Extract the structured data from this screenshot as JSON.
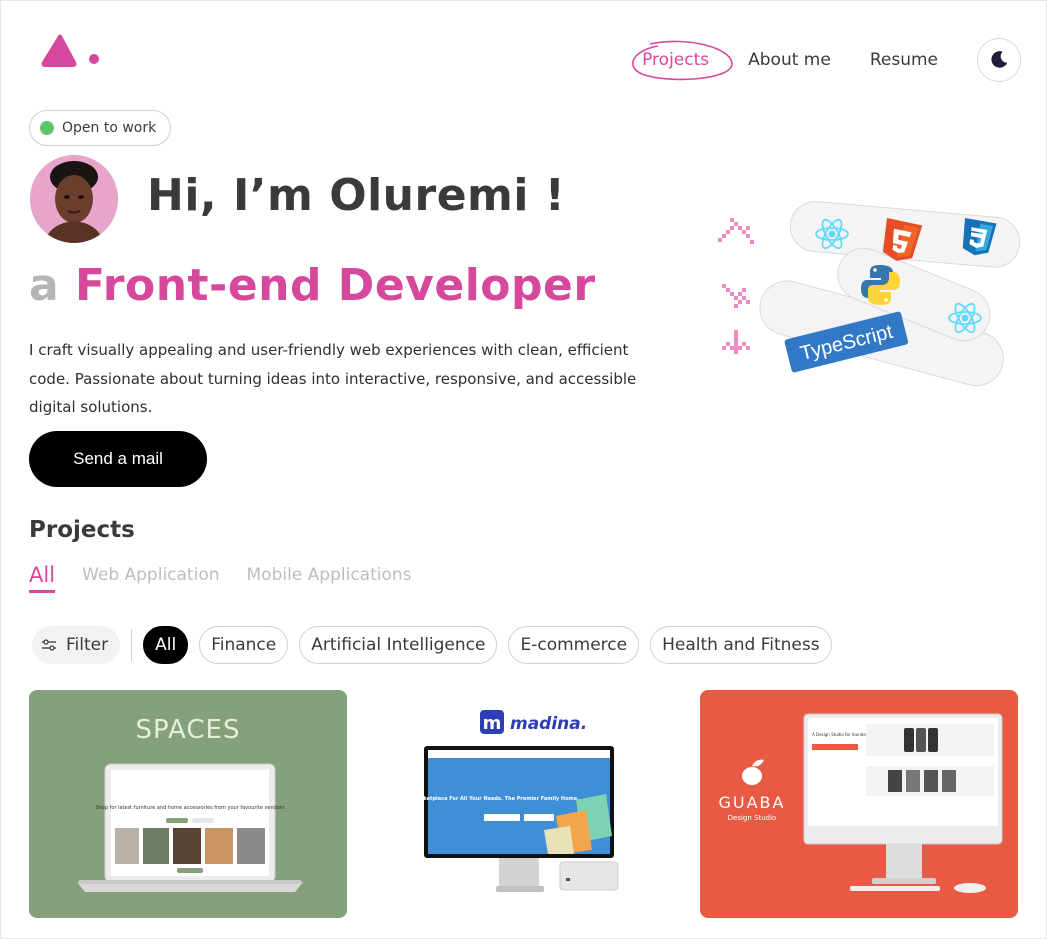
{
  "nav": {
    "items": [
      "Projects",
      "About me",
      "Resume"
    ],
    "active": "Projects"
  },
  "status_badge": "Open to work",
  "hero": {
    "greeting": "Hi, I’m Oluremi !",
    "role_prefix": "a",
    "role_title": "Front-end Developer",
    "intro": "I craft visually appealing and user-friendly web experiences with clean, efficient code. Passionate about turning ideas into interactive, responsive, and accessible digital solutions.",
    "cta": "Send a mail"
  },
  "tech_logos": [
    "react-icon",
    "html5-icon",
    "css3-icon",
    "python-icon",
    "react-icon",
    "typescript-icon"
  ],
  "tech_text": {
    "typescript": "TypeScript"
  },
  "projects": {
    "heading": "Projects",
    "tabs": [
      "All",
      "Web Application",
      "Mobile Applications"
    ],
    "active_tab": "All",
    "filter_label": "Filter",
    "chips": [
      "All",
      "Finance",
      "Artificial Intelligence",
      "E-commerce",
      "Health and Fitness"
    ],
    "active_chip": "All",
    "cards": [
      {
        "brand": "SPACES",
        "thumb_text": "Shop for latest furniture and home accessories from your favourite vendors"
      },
      {
        "brand": "madina.",
        "thumb_text": "One Stop Marketplace For All Your Needs. The Premier Family Home."
      },
      {
        "brand": "GUABA",
        "sub": "Design Studio",
        "thumb_text": "A Design Studio for founders"
      }
    ]
  },
  "colors": {
    "accent": "#d6489b",
    "spaces_bg": "#84a17b",
    "guaba_bg": "#e85a44",
    "status_dot": "#5cc46a"
  }
}
